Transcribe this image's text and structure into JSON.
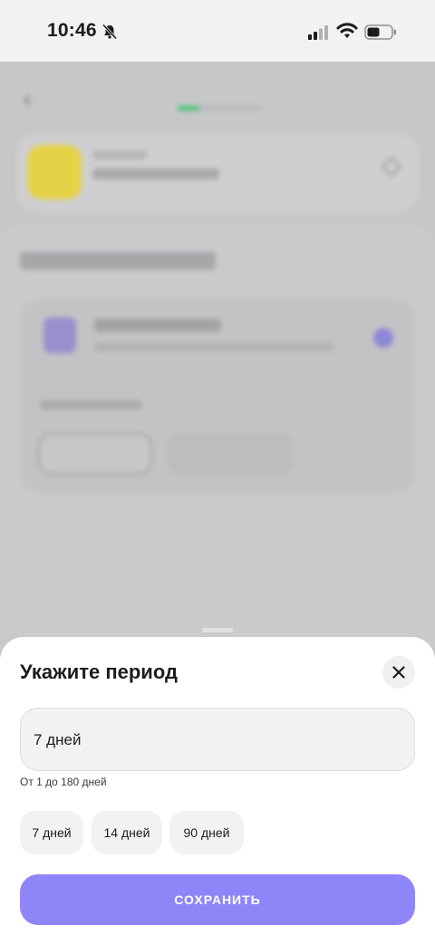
{
  "status_bar": {
    "time": "10:46",
    "icons": [
      "bell-slash-icon",
      "signal-icon",
      "wifi-icon",
      "battery-icon"
    ]
  },
  "sheet": {
    "title": "Укажите период",
    "close_icon": "close-icon",
    "field_value": "7 дней",
    "hint": "От 1 до 180 дней",
    "chips": [
      "7 дней",
      "14 дней",
      "90 дней"
    ],
    "save_label": "СОХРАНИТЬ"
  },
  "colors": {
    "accent": "#8e86f8",
    "sheet_bg": "#ffffff",
    "chip_bg": "#f2f2f5",
    "overlay": "#c7c7c9"
  }
}
